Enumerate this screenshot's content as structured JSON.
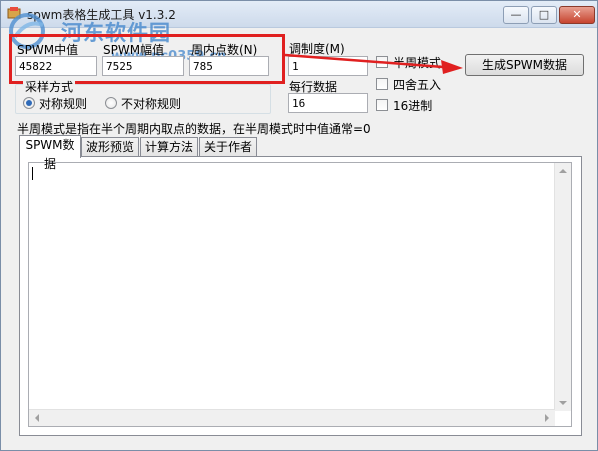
{
  "window": {
    "title": "spwm表格生成工具 v1.3.2",
    "minimize": "—",
    "maximize": "□",
    "close": "✕"
  },
  "watermark": {
    "text": "河东软件园",
    "url": "www.pc0359.cn"
  },
  "params": {
    "mid_label": "SPWM中值",
    "mid_value": "45822",
    "amp_label": "SPWM幅值",
    "amp_value": "7525",
    "points_label": "周内点数(N)",
    "points_value": "785",
    "mod_label": "调制度(M)",
    "mod_value": "1",
    "per_row_label": "每行数据",
    "per_row_value": "16"
  },
  "sampling": {
    "legend": "采样方式",
    "option_symmetric": "对称规则",
    "option_asymmetric": "不对称规则",
    "selected": "对称规则"
  },
  "options": {
    "half_cycle": "半周模式",
    "round": "四舍五入",
    "hex": "16进制"
  },
  "generate_button": "生成SPWM数据",
  "hint": "半周模式是指在半个周期内取点的数据，在半周模式时中值通常=0",
  "tabs": [
    "SPWM数据",
    "波形预览",
    "计算方法",
    "关于作者"
  ],
  "output_text": "",
  "colors": {
    "highlight_box": "#e02020",
    "title_gradient_top": "#e3ecf7",
    "close_button": "#c7442f"
  }
}
